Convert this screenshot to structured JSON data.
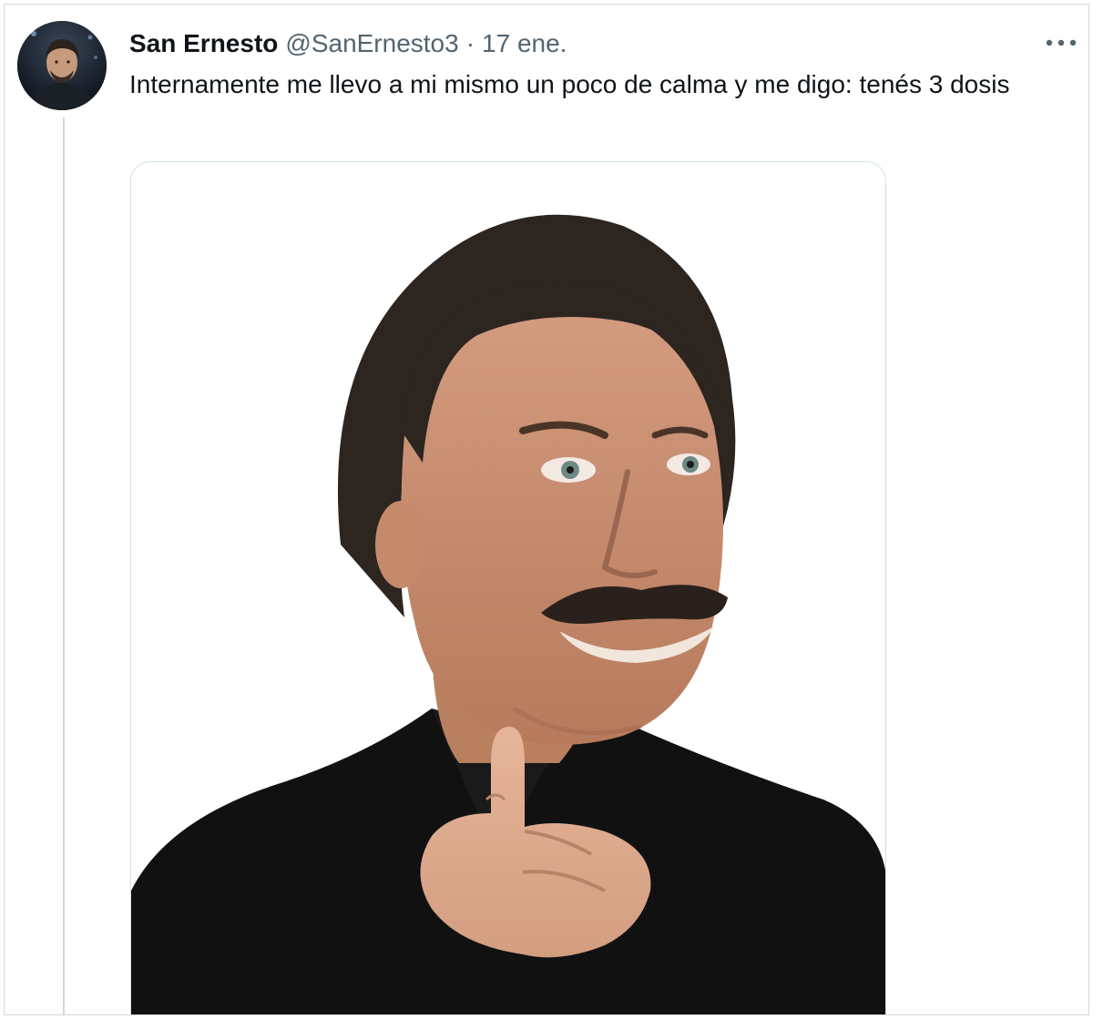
{
  "tweet": {
    "author_name": "San Ernesto",
    "handle": "@SanErnesto3",
    "separator": "·",
    "date": "17 ene.",
    "more_glyph": "•••",
    "text": "Internamente me llevo a mi mismo un poco de calma y me digo: tenés 3 dosis"
  },
  "icons": {
    "more": "more-horizontal-icon"
  },
  "colors": {
    "text_primary": "#0f1419",
    "text_secondary": "#536471",
    "border": "#d4d9dd"
  }
}
